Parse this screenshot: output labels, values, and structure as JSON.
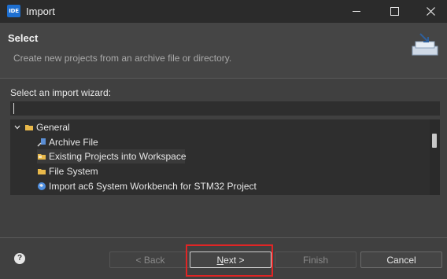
{
  "window": {
    "app_icon_text": "IDE",
    "title": "Import"
  },
  "header": {
    "title": "Select",
    "description": "Create new projects from an archive file or directory."
  },
  "wizard": {
    "label": "Select an import wizard:",
    "filter_value": "",
    "tree": [
      {
        "label": "General",
        "level": 0,
        "expanded": true,
        "icon": "folder-icon"
      },
      {
        "label": "Archive File",
        "level": 1,
        "icon": "archive-icon"
      },
      {
        "label": "Existing Projects into Workspace",
        "level": 1,
        "icon": "project-folder-icon",
        "selected": true
      },
      {
        "label": "File System",
        "level": 1,
        "icon": "folder-icon"
      },
      {
        "label": "Import ac6 System Workbench for STM32 Project",
        "level": 1,
        "icon": "globe-icon"
      }
    ]
  },
  "footer": {
    "help_glyph": "?",
    "back_label": "< Back",
    "next_label_prefix": "",
    "next_label_mnemonic": "N",
    "next_label_rest": "ext >",
    "finish_label": "Finish",
    "cancel_label": "Cancel"
  },
  "colors": {
    "accent": "#1e6fd0",
    "highlight_box": "#e02525"
  }
}
